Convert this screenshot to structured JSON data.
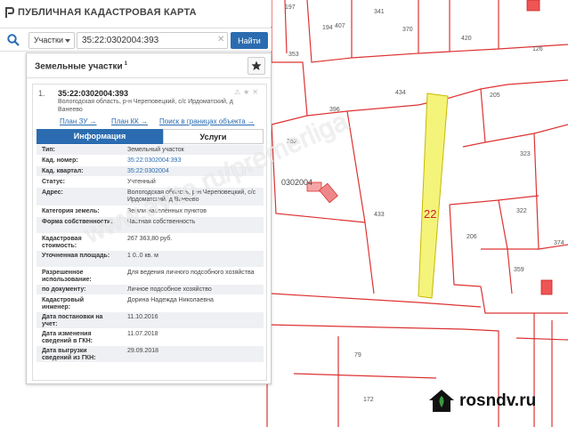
{
  "app": {
    "title": "ПУБЛИЧНАЯ КАДАСТРОВАЯ КАРТА"
  },
  "search": {
    "type_label": "Участки",
    "value": "35:22:0302004:393",
    "find_label": "Найти"
  },
  "panel": {
    "title": "Земельные участки",
    "count": "1",
    "result": {
      "index": "1.",
      "id": "35:22:0302004:393",
      "address": "Вологодская область, р-н Череповецкий, с/с Ирдоматский, д Ванеево",
      "links": {
        "plan_zu": "План ЗУ →",
        "plan_kk": "План КК →",
        "search": "Поиск в границах объекта →"
      }
    },
    "tabs": {
      "info": "Информация",
      "services": "Услуги"
    },
    "rows": [
      {
        "key": "Тип:",
        "value": "Земельный участок"
      },
      {
        "key": "Кад. номер:",
        "value": "35:22:0302004:393"
      },
      {
        "key": "Кад. квартал:",
        "value": "35:22:0302004"
      },
      {
        "key": "Статус:",
        "value": "Учтенный"
      },
      {
        "key": "Адрес:",
        "value": "Вологодская область, р-н Череповецкий, с/с Ирдоматский, д Ванеево"
      },
      {
        "key": "Категория земель:",
        "value": "Земли населённых пунктов"
      },
      {
        "key": "Форма собственности:",
        "value": "Частная собственность"
      },
      {
        "key": "Кадастровая стоимость:",
        "value": "267 363,80 руб."
      },
      {
        "key": "Уточненная площадь:",
        "value": "1 0..0 кв. м"
      },
      {
        "key": "Разрешенное использование:",
        "value": "Для ведения личного подсобного хозяйства"
      },
      {
        "key": "по документу:",
        "value": "Личное подсобное хозяйство"
      },
      {
        "key": "Кадастровый инженер:",
        "value": "Дорина Надежда Николаевна"
      },
      {
        "key": "Дата постановки на учет:",
        "value": "11.10.2016"
      },
      {
        "key": "Дата изменения сведений в ГКН:",
        "value": "11.07.2018"
      },
      {
        "key": "Дата выгрузки сведений из ГКН:",
        "value": "29.09.2018"
      }
    ]
  },
  "map": {
    "labels": [
      "197",
      "194",
      "407",
      "341",
      "370",
      "420",
      "126",
      "353",
      "205",
      "434",
      "396",
      "352",
      "323",
      "0302004",
      "22",
      "433",
      "322",
      "374",
      "206",
      "359",
      "79",
      "172"
    ]
  },
  "watermark": "www.avito.ru/premerliga",
  "brand": {
    "text": "rosndv.ru"
  },
  "colors": {
    "accent": "#2b6cb0",
    "parcel_highlight": "#f4f47a",
    "boundary": "#d33"
  }
}
